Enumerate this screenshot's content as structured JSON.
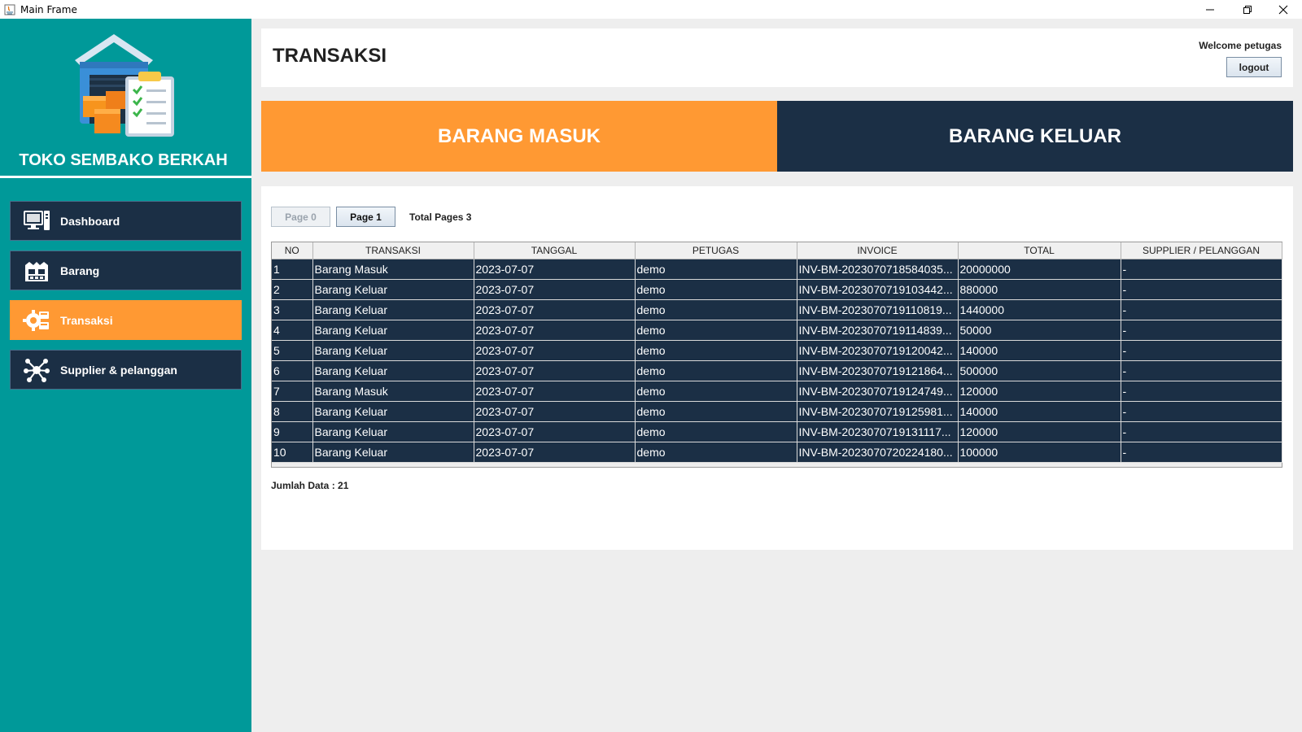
{
  "window": {
    "title": "Main Frame"
  },
  "sidebar": {
    "brand": "TOKO SEMBAKO BERKAH",
    "items": [
      {
        "label": "Dashboard",
        "icon": "monitor-icon"
      },
      {
        "label": "Barang",
        "icon": "warehouse-icon"
      },
      {
        "label": "Transaksi",
        "icon": "gear-transaction-icon"
      },
      {
        "label": "Supplier & pelanggan",
        "icon": "network-icon"
      }
    ],
    "active_index": 2
  },
  "header": {
    "title": "TRANSAKSI",
    "welcome": "Welcome petugas",
    "logout_label": "logout"
  },
  "tabs": {
    "masuk": "BARANG MASUK",
    "keluar": "BARANG KELUAR"
  },
  "pagination": {
    "prev_label": "Page 0",
    "current_label": "Page 1",
    "total_pages": "Total Pages 3"
  },
  "table": {
    "columns": [
      "NO",
      "TRANSAKSI",
      "TANGGAL",
      "PETUGAS",
      "INVOICE",
      "TOTAL",
      "SUPPLIER / PELANGGAN"
    ],
    "rows": [
      [
        "1",
        "Barang Masuk",
        "2023-07-07",
        "demo",
        "INV-BM-2023070718584035...",
        "20000000",
        "-"
      ],
      [
        "2",
        "Barang Keluar",
        "2023-07-07",
        "demo",
        "INV-BM-2023070719103442...",
        "880000",
        "-"
      ],
      [
        "3",
        "Barang Keluar",
        "2023-07-07",
        "demo",
        "INV-BM-2023070719110819...",
        "1440000",
        "-"
      ],
      [
        "4",
        "Barang Keluar",
        "2023-07-07",
        "demo",
        "INV-BM-2023070719114839...",
        "50000",
        "-"
      ],
      [
        "5",
        "Barang Keluar",
        "2023-07-07",
        "demo",
        "INV-BM-2023070719120042...",
        "140000",
        "-"
      ],
      [
        "6",
        "Barang Keluar",
        "2023-07-07",
        "demo",
        "INV-BM-2023070719121864...",
        "500000",
        "-"
      ],
      [
        "7",
        "Barang Masuk",
        "2023-07-07",
        "demo",
        "INV-BM-2023070719124749...",
        "120000",
        "-"
      ],
      [
        "8",
        "Barang Keluar",
        "2023-07-07",
        "demo",
        "INV-BM-2023070719125981...",
        "140000",
        "-"
      ],
      [
        "9",
        "Barang Keluar",
        "2023-07-07",
        "demo",
        "INV-BM-2023070719131117...",
        "120000",
        "-"
      ],
      [
        "10",
        "Barang Keluar",
        "2023-07-07",
        "demo",
        "INV-BM-2023070720224180...",
        "100000",
        "-"
      ]
    ]
  },
  "footer": {
    "jumlah": "Jumlah Data : 21"
  },
  "colors": {
    "sidebar": "#009999",
    "nav": "#1b2f45",
    "accent": "#ff9933"
  }
}
